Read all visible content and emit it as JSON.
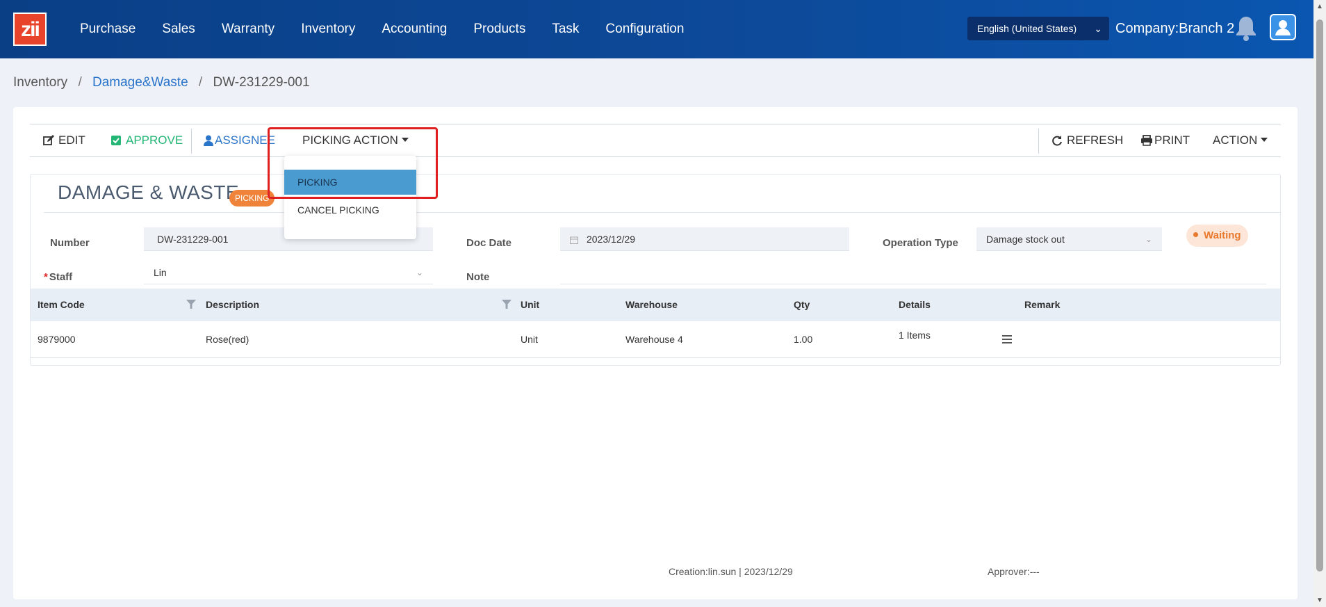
{
  "topnav": {
    "logo_text": "zii",
    "items": [
      "Purchase",
      "Sales",
      "Warranty",
      "Inventory",
      "Accounting",
      "Products",
      "Task",
      "Configuration"
    ],
    "language": "English (United States)",
    "company": "Company:Branch 2"
  },
  "breadcrumb": {
    "root": "Inventory",
    "section": "Damage&Waste",
    "current": "DW-231229-001"
  },
  "toolbar": {
    "edit": "EDIT",
    "approve": "APPROVE",
    "assignee": "ASSIGNEE",
    "picking_action": "PICKING ACTION",
    "refresh": "REFRESH",
    "print": "PRINT",
    "action": "ACTION"
  },
  "dropdown": {
    "items": [
      "PICKING",
      "CANCEL PICKING"
    ],
    "active": "PICKING"
  },
  "form": {
    "title": "DAMAGE & WASTE",
    "status_tag": "PICKING",
    "number_label": "Number",
    "number_value": "DW-231229-001",
    "doc_date_label": "Doc Date",
    "doc_date_value": "2023/12/29",
    "operation_type_label": "Operation Type",
    "operation_type_value": "Damage stock out",
    "state": "Waiting",
    "staff_label": "Staff",
    "staff_value": "Lin",
    "note_label": "Note",
    "note_value": ""
  },
  "table": {
    "headers": [
      "Item Code",
      "Description",
      "Unit",
      "Warehouse",
      "Qty",
      "Details",
      "Remark"
    ],
    "rows": [
      {
        "item_code": "9879000",
        "description": "Rose(red)",
        "unit": "Unit",
        "warehouse": "Warehouse 4",
        "qty": "1.00",
        "details": "1 Items",
        "remark": ""
      }
    ]
  },
  "footer": {
    "creation": "Creation:lin.sun | 2023/12/29",
    "approver": "Approver:---"
  },
  "colors": {
    "nav_bg": "#0d4a9a",
    "accent_blue": "#2a74c9",
    "approve_green": "#22b573",
    "status_orange": "#f0833a",
    "highlight_red": "#e02020"
  }
}
